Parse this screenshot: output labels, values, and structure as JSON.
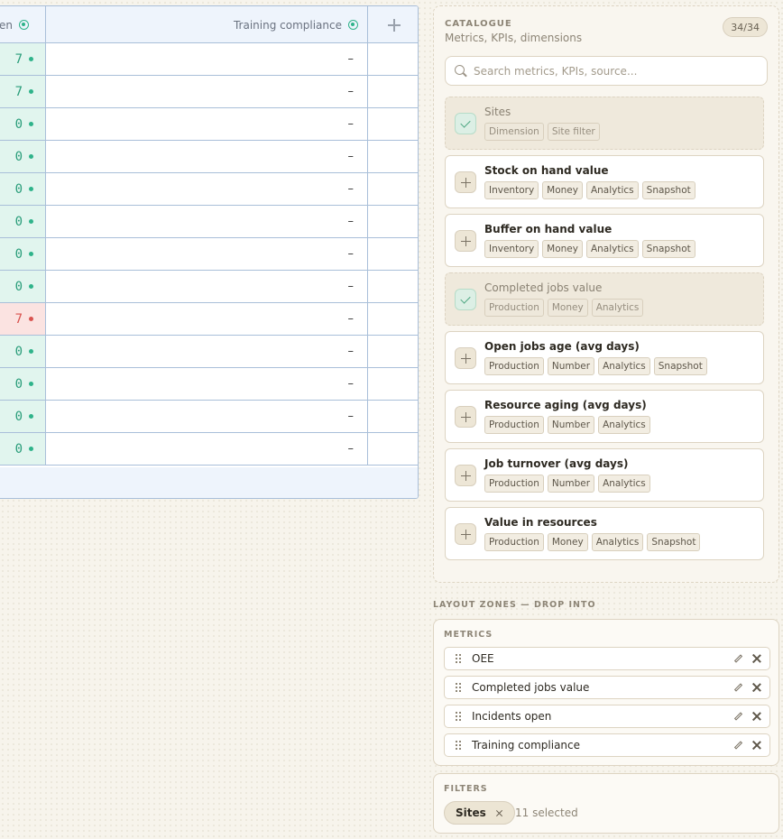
{
  "table": {
    "columns": [
      {
        "label": "en",
        "icon": "status-dot-icon"
      },
      {
        "label": "Training compliance",
        "icon": "status-dot-icon"
      },
      {
        "icon": "add-column-icon"
      }
    ],
    "rows": [
      {
        "open": "7",
        "status": "ok",
        "training": "–"
      },
      {
        "open": "7",
        "status": "ok",
        "training": "–"
      },
      {
        "open": "0",
        "status": "ok",
        "training": "–"
      },
      {
        "open": "0",
        "status": "ok",
        "training": "–"
      },
      {
        "open": "0",
        "status": "ok",
        "training": "–"
      },
      {
        "open": "0",
        "status": "ok",
        "training": "–"
      },
      {
        "open": "0",
        "status": "ok",
        "training": "–"
      },
      {
        "open": "0",
        "status": "ok",
        "training": "–"
      },
      {
        "open": "7",
        "status": "alert",
        "training": "–"
      },
      {
        "open": "0",
        "status": "ok",
        "training": "–"
      },
      {
        "open": "0",
        "status": "ok",
        "training": "–"
      },
      {
        "open": "0",
        "status": "ok",
        "training": "–"
      },
      {
        "open": "0",
        "status": "ok",
        "training": "–"
      }
    ]
  },
  "catalogue": {
    "title": "CATALOGUE",
    "subtitle": "Metrics, KPIs, dimensions",
    "count": "34/34",
    "search_placeholder": "Search metrics, KPIs, source...",
    "items": [
      {
        "name": "Sites",
        "selected": true,
        "tags": [
          "Dimension",
          "Site filter"
        ]
      },
      {
        "name": "Stock on hand value",
        "selected": false,
        "tags": [
          "Inventory",
          "Money",
          "Analytics",
          "Snapshot"
        ]
      },
      {
        "name": "Buffer on hand value",
        "selected": false,
        "tags": [
          "Inventory",
          "Money",
          "Analytics",
          "Snapshot"
        ]
      },
      {
        "name": "Completed jobs value",
        "selected": true,
        "tags": [
          "Production",
          "Money",
          "Analytics"
        ]
      },
      {
        "name": "Open jobs age (avg days)",
        "selected": false,
        "tags": [
          "Production",
          "Number",
          "Analytics",
          "Snapshot"
        ]
      },
      {
        "name": "Resource aging (avg days)",
        "selected": false,
        "tags": [
          "Production",
          "Number",
          "Analytics"
        ]
      },
      {
        "name": "Job turnover (avg days)",
        "selected": false,
        "tags": [
          "Production",
          "Number",
          "Analytics"
        ]
      },
      {
        "name": "Value in resources",
        "selected": false,
        "tags": [
          "Production",
          "Money",
          "Analytics",
          "Snapshot"
        ]
      }
    ]
  },
  "zones": {
    "title": "LAYOUT ZONES — DROP INTO",
    "metrics_label": "METRICS",
    "metrics": [
      "OEE",
      "Completed jobs value",
      "Incidents open",
      "Training compliance"
    ],
    "filters_label": "FILTERS",
    "filter_chip": "Sites",
    "filter_count": "11 selected"
  },
  "colors": {
    "ok": "#2fb38a",
    "alert": "#d9534f",
    "background": "#f7f4ec",
    "table_border": "#a9bfd9"
  }
}
